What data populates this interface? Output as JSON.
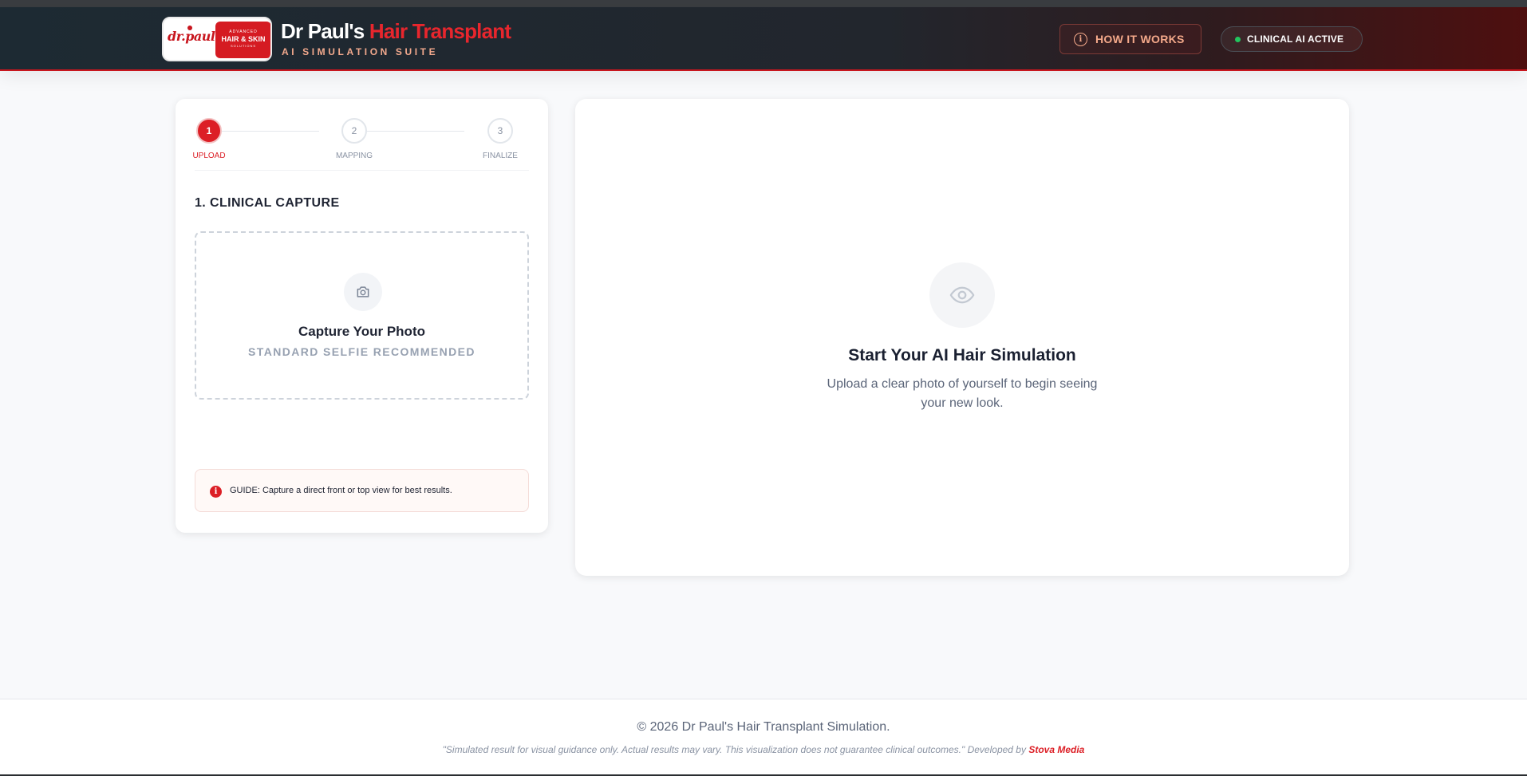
{
  "header": {
    "logo": {
      "script_text": "dr.paul's",
      "badge_line1": "ADVANCED",
      "badge_line2": "HAIR & SKIN",
      "badge_line3": "SOLUTIONS"
    },
    "brand_prefix": "Dr Paul's",
    "brand_accent": "Hair Transplant",
    "subtitle": "AI SIMULATION SUITE",
    "how_it_works_label": "HOW IT WORKS",
    "status_label": "CLINICAL AI ACTIVE",
    "status_color": "#22c55e",
    "accent_color": "#dc1f26"
  },
  "steps": [
    {
      "number": "1",
      "label": "UPLOAD",
      "active": true
    },
    {
      "number": "2",
      "label": "MAPPING",
      "active": false
    },
    {
      "number": "3",
      "label": "FINALIZE",
      "active": false
    }
  ],
  "capture": {
    "section_title": "1. CLINICAL CAPTURE",
    "title": "Capture Your Photo",
    "subtitle": "STANDARD SELFIE RECOMMENDED",
    "icon": "camera-icon"
  },
  "guide": {
    "icon": "info-icon",
    "text": "GUIDE: Capture a direct front or top view for best results."
  },
  "preview": {
    "icon": "eye-icon",
    "title": "Start Your AI Hair Simulation",
    "description": "Upload a clear photo of yourself to begin seeing your new look."
  },
  "footer": {
    "copyright": "© 2026 Dr Paul's Hair Transplant Simulation.",
    "disclaimer": "\"Simulated result for visual guidance only. Actual results may vary. This visualization does not guarantee clinical outcomes.\" Developed by",
    "developer": "Stova Media"
  }
}
